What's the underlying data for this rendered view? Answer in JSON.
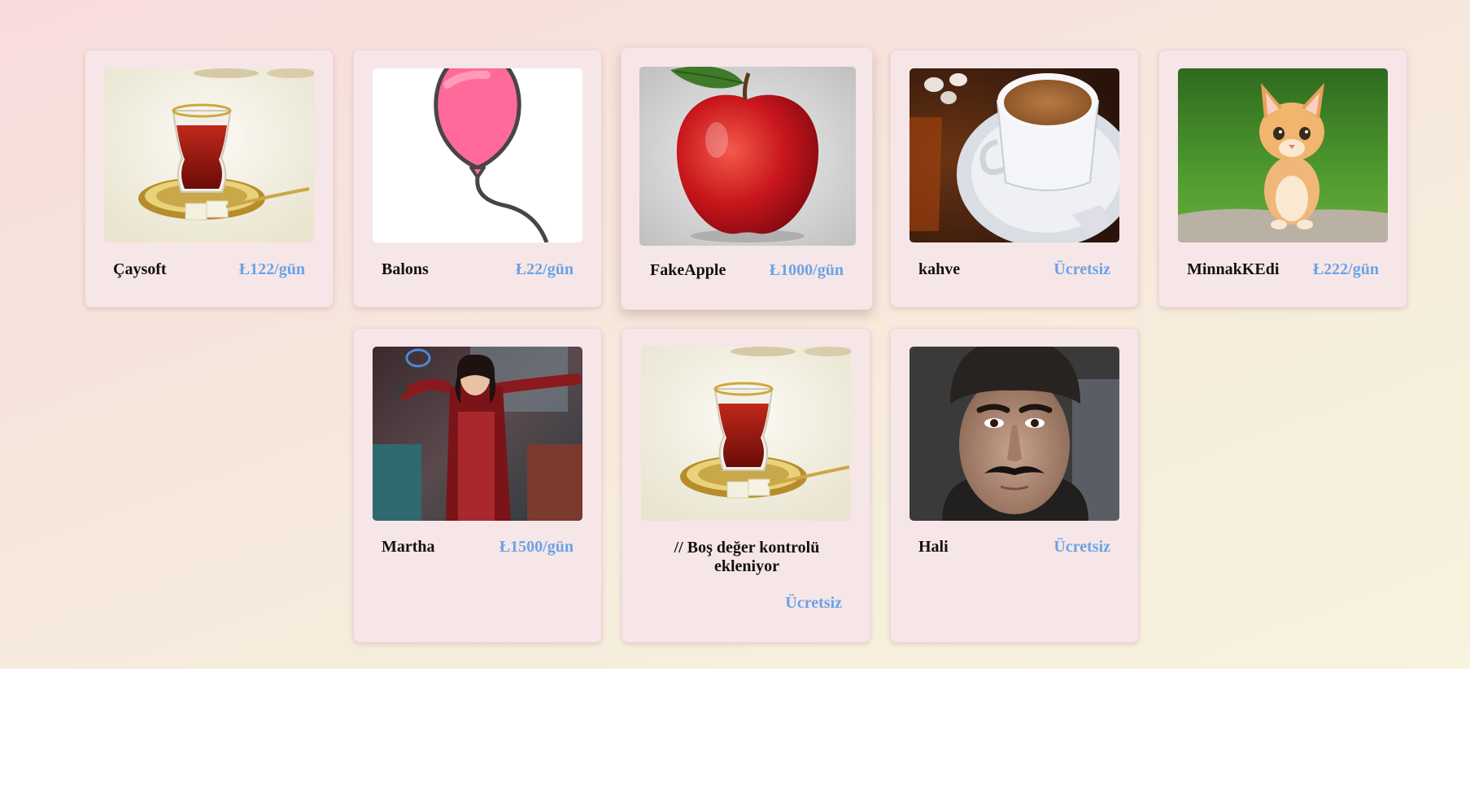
{
  "products": [
    {
      "name": "Çaysoft",
      "price": "Ł122/gün",
      "image_icon": "turkish-tea-glass"
    },
    {
      "name": "Balons",
      "price": "Ł22/gün",
      "image_icon": "pink-balloon"
    },
    {
      "name": "FakeApple",
      "price": "Ł1000/gün",
      "image_icon": "red-apple"
    },
    {
      "name": "kahve",
      "price": "Ücretsiz",
      "image_icon": "turkish-coffee-cup"
    },
    {
      "name": "MinnakKEdi",
      "price": "Ł222/gün",
      "image_icon": "orange-kitten"
    },
    {
      "name": "Martha",
      "price": "Ł1500/gün",
      "image_icon": "woman-in-red-coat"
    },
    {
      "name": "// Boş değer kontrolü ekleniyor",
      "price": "Ücretsiz",
      "image_icon": "turkish-tea-glass"
    },
    {
      "name": "Hali",
      "price": "Ücretsiz",
      "image_icon": "man-portrait"
    }
  ],
  "colors": {
    "card_bg": "#f7e6e8",
    "price_text": "#6aa3e6",
    "name_text": "#111111"
  }
}
